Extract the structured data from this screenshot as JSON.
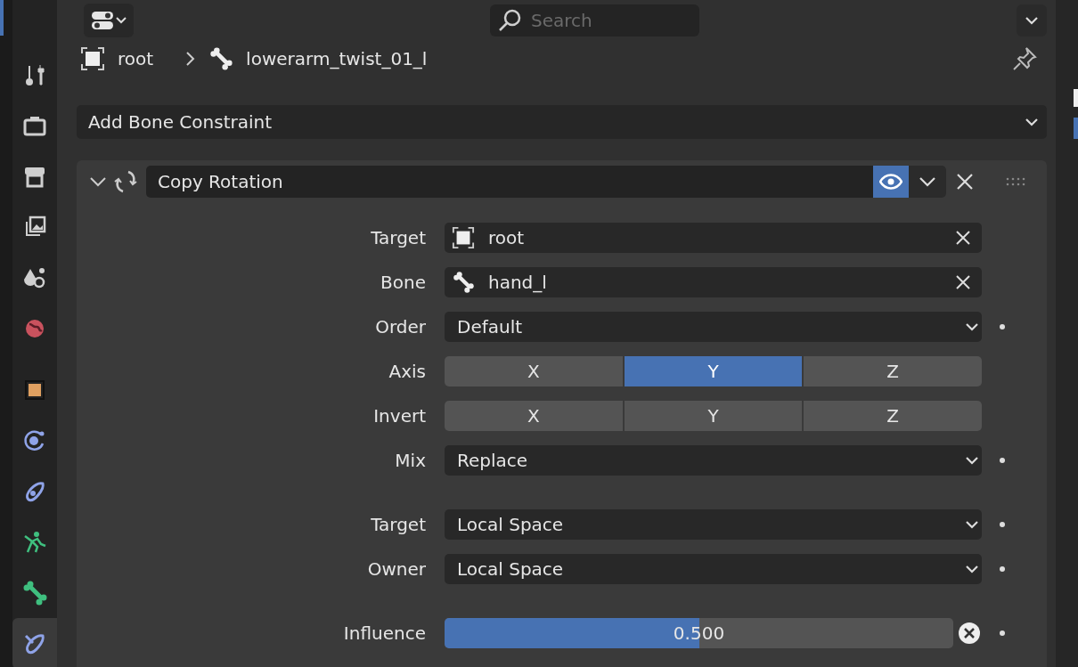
{
  "header": {
    "search": {
      "placeholder": "Search"
    }
  },
  "sidebar": {
    "groups": [
      [
        {
          "kind": "tool",
          "selected": false
        },
        {
          "kind": "render",
          "selected": false
        },
        {
          "kind": "output",
          "selected": false
        },
        {
          "kind": "view_layer",
          "selected": false
        },
        {
          "kind": "scene",
          "selected": false
        },
        {
          "kind": "world",
          "selected": false
        }
      ],
      [
        {
          "kind": "object",
          "selected": false
        },
        {
          "kind": "physics",
          "selected": false
        },
        {
          "kind": "object_constraint",
          "selected": false
        },
        {
          "kind": "armature",
          "selected": false
        },
        {
          "kind": "bone",
          "selected": false
        },
        {
          "kind": "bone_constraint",
          "selected": true
        }
      ]
    ]
  },
  "breadcrumb": [
    {
      "kind": "object",
      "label": "root"
    },
    {
      "kind": "bone",
      "label": "lowerarm_twist_01_l"
    }
  ],
  "add_menu": "Add Bone Constraint",
  "constraint": {
    "name": "Copy Rotation",
    "expanded": true,
    "visible": true,
    "sections": [
      [
        {
          "kind": "object",
          "label": "Target",
          "value": "root"
        },
        {
          "kind": "bone",
          "label": "Bone",
          "value": "hand_l"
        },
        {
          "kind": "dropdown",
          "label": "Order",
          "value": "Default",
          "animatable": true
        },
        {
          "kind": "toggles",
          "label": "Axis",
          "options": [
            {
              "label": "X",
              "selected": false
            },
            {
              "label": "Y",
              "selected": true
            },
            {
              "label": "Z",
              "selected": false
            }
          ]
        },
        {
          "kind": "toggles",
          "label": "Invert",
          "options": [
            {
              "label": "X",
              "selected": false
            },
            {
              "label": "Y",
              "selected": false
            },
            {
              "label": "Z",
              "selected": false
            }
          ]
        },
        {
          "kind": "dropdown",
          "label": "Mix",
          "value": "Replace",
          "animatable": true
        }
      ],
      [
        {
          "kind": "dropdown",
          "label": "Target",
          "value": "Local Space",
          "animatable": true
        },
        {
          "kind": "dropdown",
          "label": "Owner",
          "value": "Local Space",
          "animatable": true
        }
      ],
      [
        {
          "kind": "slider",
          "label": "Influence",
          "value": "0.500",
          "level": 0.5,
          "animatable": true
        }
      ]
    ]
  }
}
